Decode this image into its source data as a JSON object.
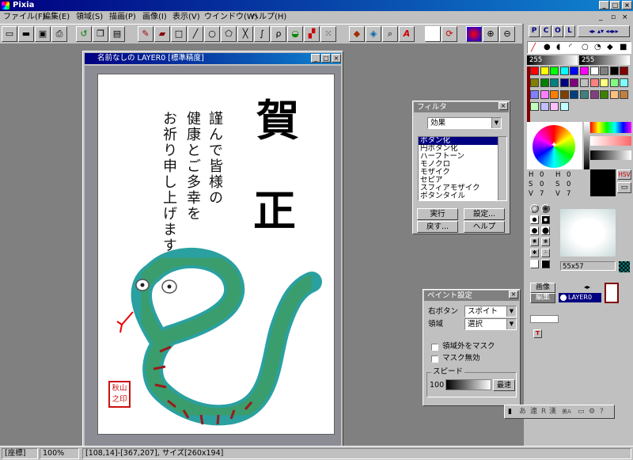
{
  "app": {
    "title": "Pixia"
  },
  "menu": [
    "ファイル(F)",
    "編集(E)",
    "領域(S)",
    "描画(P)",
    "画像(I)",
    "表示(V)",
    "ウインドウ(W)",
    "ヘルプ(H)"
  ],
  "toolbar": {
    "icons": [
      "new-file-icon",
      "open-file-icon",
      "save-icon",
      "print-icon",
      "undo-icon",
      "copy-icon",
      "paste-icon",
      "pencil-icon",
      "eraser-icon",
      "rectangle-icon",
      "line-icon",
      "ellipse-icon",
      "polygon-icon",
      "cross-line-icon",
      "curve-icon",
      "lasso-icon",
      "bucket-fill-icon",
      "select-fill-icon",
      "dotted-select-icon",
      "paint-icon",
      "stamp-icon",
      "zoom-icon",
      "text-icon",
      "color-swatch-icon",
      "rotate-icon",
      "color-wheel-icon",
      "zoom-in-icon",
      "zoom-out-icon"
    ]
  },
  "document": {
    "title": "名前なしの LAYER0 [標準精度]",
    "greeting_big_1": "賀",
    "greeting_big_2": "正",
    "greeting_col_1": "謹んで皆様の",
    "greeting_col_2": "健康とご多幸を",
    "greeting_col_3": "お祈り申し上げます",
    "seal_text": "秋山之印",
    "seal_color": "#cc1111",
    "snake_body_color": "#2aa0a0",
    "snake_fill_color": "#4a9a3a",
    "snake_stripe_color": "#9a1a1a"
  },
  "filter_panel": {
    "title": "フィルタ",
    "category": "効果",
    "items": [
      "ボタン化",
      "円ボタン化",
      "ハーフトーン",
      "モノクロ",
      "モザイク",
      "セピア",
      "スフィアモザイク",
      "ボタンタイル"
    ],
    "selected_index": 0,
    "buttons": {
      "execute": "実行",
      "settings": "設定...",
      "revert": "戻す...",
      "help": "ヘルプ"
    }
  },
  "paint_panel": {
    "title": "ペイント設定",
    "right_button_label": "右ボタン",
    "right_button_value": "スポイト",
    "area_label": "領域",
    "area_value": "選択",
    "mask_outside_label": "領域外をマスク",
    "mask_disable_label": "マスク無効",
    "speed_label": "スピード",
    "speed_value": "100",
    "speed_mode": "最速"
  },
  "right_panel": {
    "tabs": [
      "P",
      "C",
      "O",
      "L"
    ],
    "value_a": "255",
    "value_d": "255",
    "hsv": {
      "h1": "0",
      "s1": "0",
      "v1": "7",
      "h2": "0",
      "s2": "0",
      "v2": "7"
    },
    "hsv_label": "HSV",
    "brush_size": "55x57",
    "layer_tab_image": "画像",
    "layer_tab_edit": "編集",
    "layer_name": "LAYER0",
    "palette_colors": [
      "#ff0000",
      "#ffff00",
      "#00ff00",
      "#00ffff",
      "#0000ff",
      "#ff00ff",
      "#ffffff",
      "#808080",
      "#000000",
      "#800000",
      "#808000",
      "#008000",
      "#008080",
      "#000080",
      "#800080",
      "#c0c0c0",
      "#ff8080",
      "#ffff80",
      "#80ff80",
      "#80ffff",
      "#8080ff",
      "#ff80ff",
      "#ff8000",
      "#804000",
      "#004080",
      "#408080",
      "#804080",
      "#408000",
      "#ffc080",
      "#c08040",
      "#c0ffc0",
      "#c0c0ff",
      "#ffc0ff",
      "#c0ffff"
    ]
  },
  "ime_bar": {
    "a": "あ",
    "ren": "連",
    "r": "R",
    "kanji": "漢",
    "kana": "美A"
  },
  "status": {
    "mode": "[座標]",
    "zoom": "100%",
    "coords": "[108,14]-[367,207], サイズ[260x194]"
  }
}
